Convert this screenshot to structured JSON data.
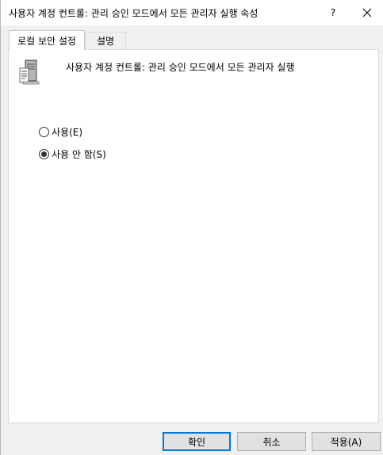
{
  "window": {
    "title": "사용자 계정 컨트롤: 관리 승인 모드에서 모든 관리자 실행 속성",
    "help_label": "?",
    "close_icon": "close-icon"
  },
  "tabs": [
    {
      "label": "로컬 보안 설정",
      "active": true
    },
    {
      "label": "설명",
      "active": false
    }
  ],
  "policy": {
    "icon": "server-icon",
    "name": "사용자 계정 컨트롤: 관리 승인 모드에서 모든 관리자 실행"
  },
  "options": [
    {
      "label": "사용(E)",
      "selected": false
    },
    {
      "label": "사용 안 함(S)",
      "selected": true
    }
  ],
  "buttons": {
    "ok_label": "확인",
    "cancel_label": "취소",
    "apply_label": "적용(A)"
  },
  "colors": {
    "default_button_border": "#0078d7",
    "panel_bg": "#ffffff",
    "window_bg": "#f0f0f0"
  }
}
